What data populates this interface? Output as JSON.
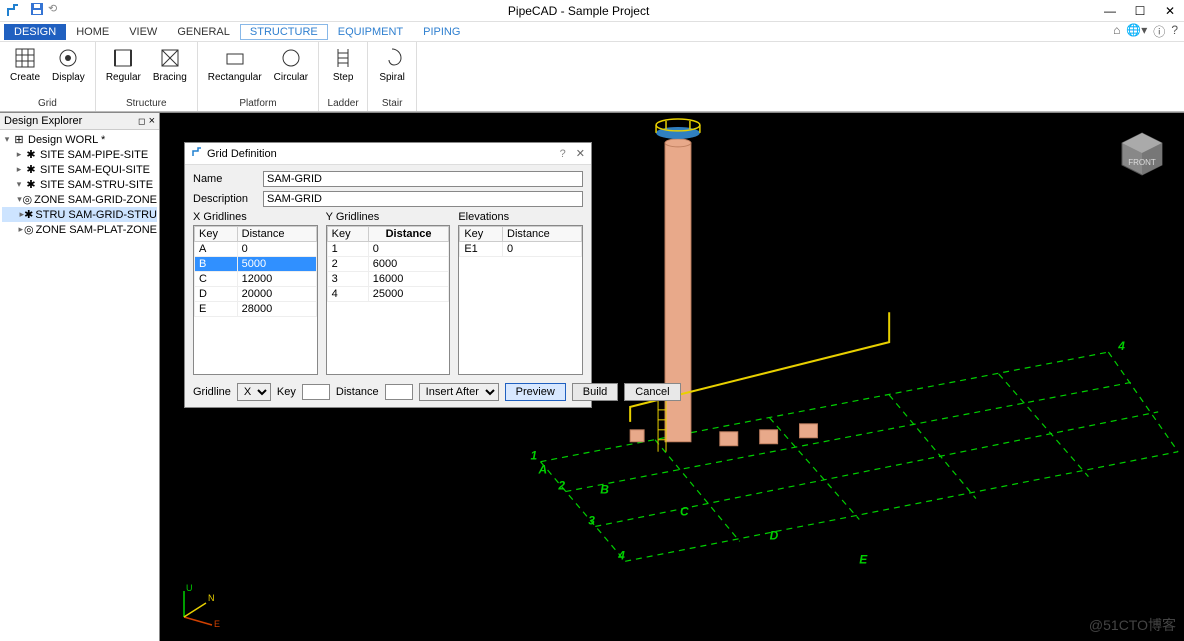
{
  "app": {
    "title": "PipeCAD - Sample Project"
  },
  "menubar": {
    "design": "DESIGN",
    "home": "HOME",
    "view": "VIEW",
    "general": "GENERAL",
    "structure": "STRUCTURE",
    "equipment": "EQUIPMENT",
    "piping": "PIPING"
  },
  "ribbon": {
    "grid": {
      "label": "Grid",
      "create": "Create",
      "display": "Display"
    },
    "structure": {
      "label": "Structure",
      "regular": "Regular",
      "bracing": "Bracing"
    },
    "platform": {
      "label": "Platform",
      "rectangular": "Rectangular",
      "circular": "Circular"
    },
    "ladder": {
      "label": "Ladder",
      "step": "Step"
    },
    "stair": {
      "label": "Stair",
      "spiral": "Spiral"
    }
  },
  "explorer": {
    "title": "Design Explorer",
    "root": "Design WORL *",
    "nodes": [
      "SITE SAM-PIPE-SITE",
      "SITE SAM-EQUI-SITE",
      "SITE SAM-STRU-SITE",
      "ZONE SAM-GRID-ZONE",
      "STRU SAM-GRID-STRU",
      "ZONE SAM-PLAT-ZONE"
    ]
  },
  "dialog": {
    "title": "Grid Definition",
    "name_label": "Name",
    "name_value": "SAM-GRID",
    "desc_label": "Description",
    "desc_value": "SAM-GRID",
    "x_header": "X Gridlines",
    "y_header": "Y Gridlines",
    "e_header": "Elevations",
    "col_key": "Key",
    "col_distance": "Distance",
    "x_rows": [
      {
        "key": "A",
        "dist": "0"
      },
      {
        "key": "B",
        "dist": "5000"
      },
      {
        "key": "C",
        "dist": "12000"
      },
      {
        "key": "D",
        "dist": "20000"
      },
      {
        "key": "E",
        "dist": "28000"
      }
    ],
    "y_rows": [
      {
        "key": "1",
        "dist": "0"
      },
      {
        "key": "2",
        "dist": "6000"
      },
      {
        "key": "3",
        "dist": "16000"
      },
      {
        "key": "4",
        "dist": "25000"
      }
    ],
    "e_rows": [
      {
        "key": "E1",
        "dist": "0"
      }
    ],
    "gridline_label": "Gridline",
    "gridline_value": "X",
    "key_label": "Key",
    "distance_label": "Distance",
    "insert_label": "Insert After",
    "preview": "Preview",
    "build": "Build",
    "cancel": "Cancel"
  },
  "watermark": "@51CTO博客"
}
